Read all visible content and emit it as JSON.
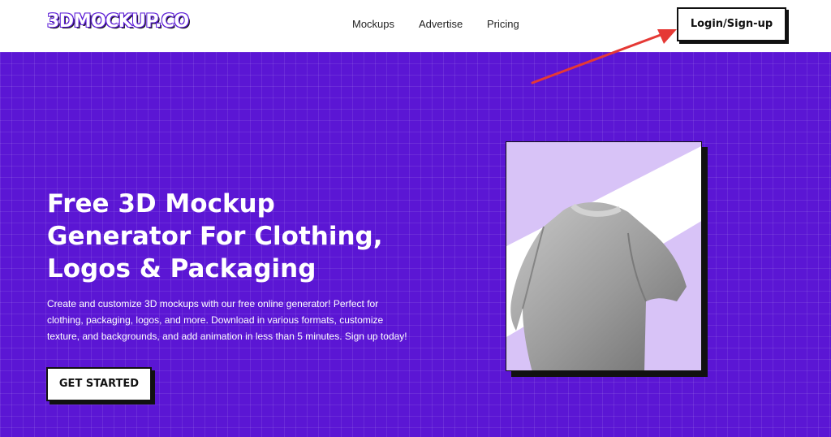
{
  "header": {
    "logo_text": "3DMOCKUP.CO",
    "nav": [
      {
        "label": "Mockups"
      },
      {
        "label": "Advertise"
      },
      {
        "label": "Pricing"
      }
    ],
    "login_label": "Login/Sign-up"
  },
  "hero": {
    "headline": "Free 3D Mockup\nGenerator For Clothing,\nLogos & Packaging",
    "description": "Create and customize 3D mockups with our free online generator! Perfect for clothing, packaging, logos, and more. Download in various formats, customize texture, and backgrounds, and add animation in less than 5 minutes. Sign up today!",
    "cta_label": "GET STARTED",
    "background_color": "#5b16d4",
    "mockup_colors": {
      "accent": "#d8c3f7",
      "shirt": "#9c9c9c"
    }
  },
  "annotation": {
    "arrow_color": "#e53935"
  }
}
